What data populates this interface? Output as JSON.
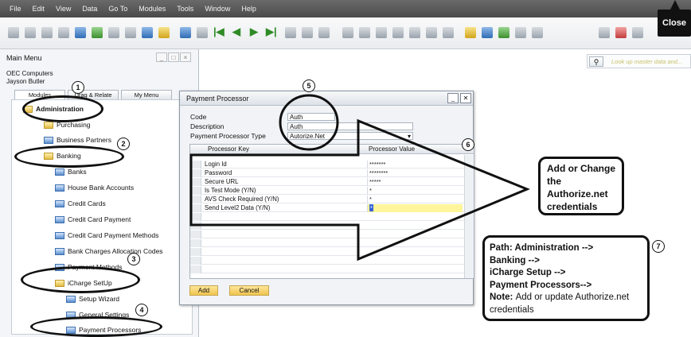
{
  "menubar": {
    "items": [
      "File",
      "Edit",
      "View",
      "Data",
      "Go To",
      "Modules",
      "Tools",
      "Window",
      "Help"
    ]
  },
  "close_button": {
    "label": "Close"
  },
  "main_menu": {
    "title": "Main Menu",
    "company": "OEC Computers",
    "user": "Jayson Butler",
    "tabs": [
      "Modules",
      "Drag & Relate",
      "My Menu"
    ],
    "tree": [
      {
        "label": "Administration",
        "icon": "folder-icon",
        "bold": true
      },
      {
        "label": "Purchasing",
        "icon": "folder-icon"
      },
      {
        "label": "Business Partners",
        "icon": "document-icon"
      },
      {
        "label": "Banking",
        "icon": "folder-icon"
      },
      {
        "label": "Banks",
        "icon": "document-icon"
      },
      {
        "label": "House Bank Accounts",
        "icon": "document-icon"
      },
      {
        "label": "Credit Cards",
        "icon": "document-icon"
      },
      {
        "label": "Credit Card Payment",
        "icon": "document-icon"
      },
      {
        "label": "Credit Card Payment Methods",
        "icon": "document-icon"
      },
      {
        "label": "Bank Charges Allocation Codes",
        "icon": "document-icon"
      },
      {
        "label": "Payment Methods",
        "icon": "document-icon"
      },
      {
        "label": "iCharge SetUp",
        "icon": "folder-icon"
      },
      {
        "label": "Setup Wizard",
        "icon": "document-icon"
      },
      {
        "label": "General Settings",
        "icon": "document-icon"
      },
      {
        "label": "Payment Processors",
        "icon": "document-icon"
      }
    ]
  },
  "dialog": {
    "title": "Payment Processor",
    "code_label": "Code",
    "code_value": "Auth",
    "description_label": "Description",
    "description_value": "Auth",
    "type_label": "Payment Processor Type",
    "type_value": "Autorize.Net",
    "col_key": "Processor Key",
    "col_value": "Processor Value",
    "rows": [
      {
        "key": "Login Id",
        "value": "*******"
      },
      {
        "key": "Password",
        "value": "********"
      },
      {
        "key": "Secure URL",
        "value": "*****"
      },
      {
        "key": "Is Test Mode (Y/N)",
        "value": "*"
      },
      {
        "key": "AVS Check Required (Y/N)",
        "value": "*"
      },
      {
        "key": "Send Level2 Data (Y/N)",
        "value": "*"
      }
    ],
    "add_label": "Add",
    "cancel_label": "Cancel"
  },
  "search": {
    "placeholder": "Look up master data and..."
  },
  "annotations": {
    "callout_credentials": "Add or Change the Authorize.net credentials",
    "path_lines": [
      "Path: Administration -->",
      "Banking -->",
      "iCharge Setup -->",
      "Payment Processors-->"
    ],
    "note_label": "Note:",
    "note_text": "Add or update Authorize.net credentials",
    "badges": [
      "1",
      "2",
      "3",
      "4",
      "5",
      "6",
      "7"
    ]
  }
}
